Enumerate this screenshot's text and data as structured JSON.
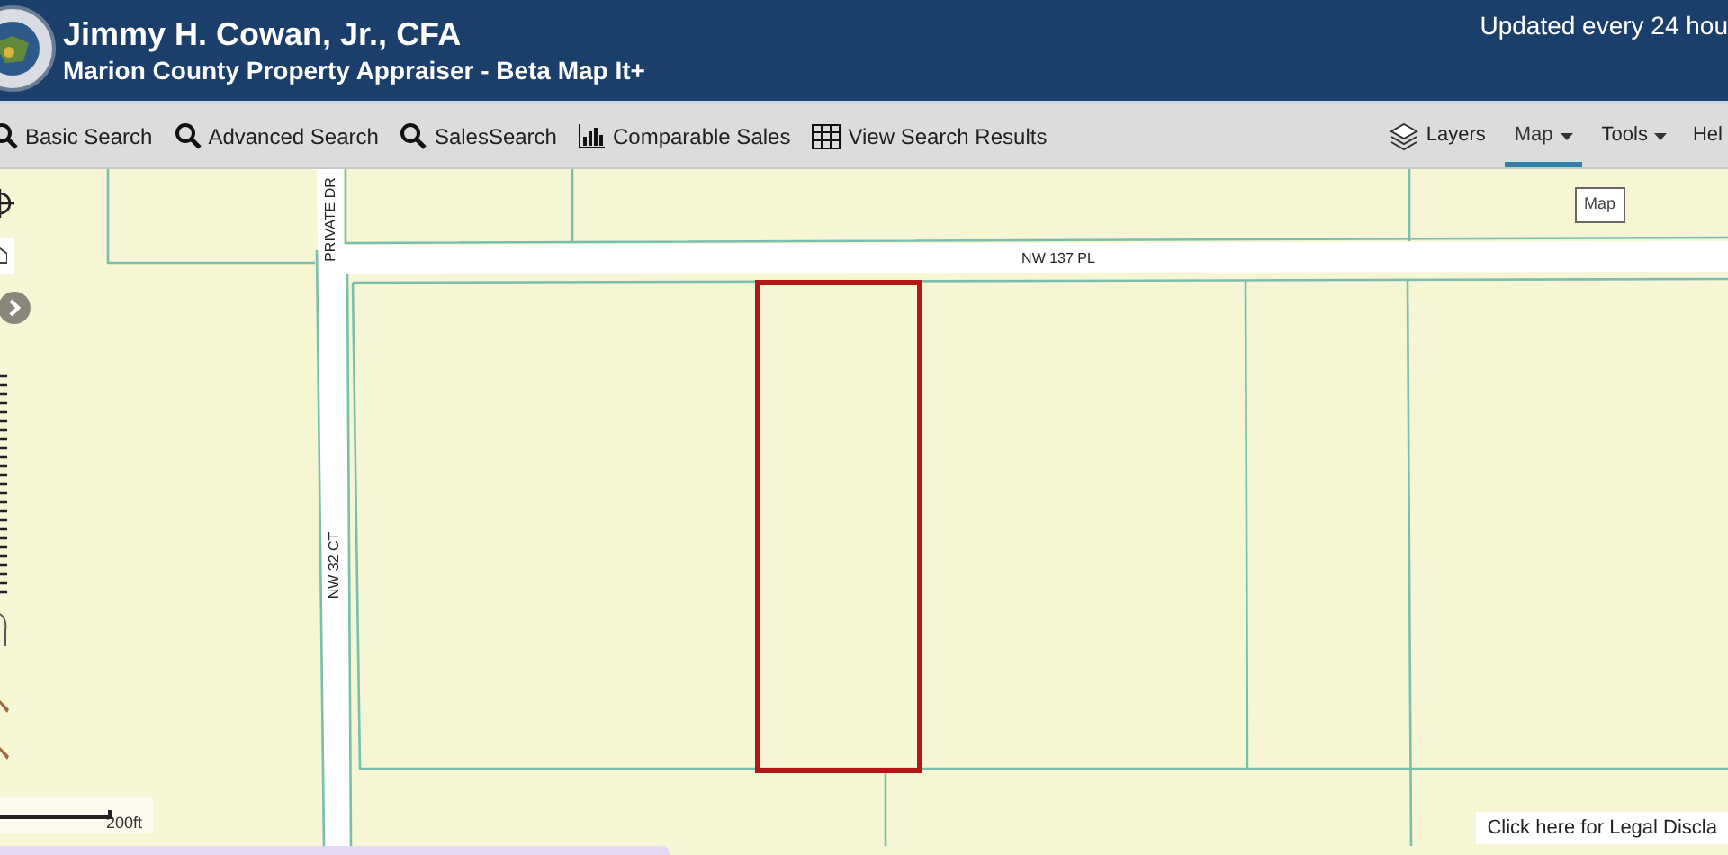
{
  "header": {
    "title": "Jimmy H. Cowan, Jr., CFA",
    "subtitle": "Marion County Property Appraiser - Beta Map It+",
    "note": "Updated every 24 hou"
  },
  "toolbar": {
    "left": [
      {
        "label": "Basic Search",
        "kind": "search"
      },
      {
        "label": "Advanced Search",
        "kind": "search"
      },
      {
        "label": "SalesSearch",
        "kind": "search"
      },
      {
        "label": "Comparable Sales",
        "kind": "chart"
      },
      {
        "label": "View Search Results",
        "kind": "table"
      }
    ],
    "right": [
      {
        "label": "Layers",
        "kind": "layers",
        "dropdown": false,
        "selected": false
      },
      {
        "label": "Map",
        "dropdown": true,
        "selected": true
      },
      {
        "label": "Tools",
        "dropdown": true,
        "selected": false
      },
      {
        "label": "Hel",
        "dropdown": false,
        "selected": false
      }
    ]
  },
  "map": {
    "roads": [
      {
        "label": "NW 137 PL",
        "kind": "horizontal"
      },
      {
        "label": "PRIVATE DR",
        "kind": "vertical"
      },
      {
        "label": "NW 32 CT",
        "kind": "vertical"
      }
    ],
    "tooltip": "Map",
    "scale": "200ft",
    "disclaimer": "Click here for Legal Discla"
  }
}
